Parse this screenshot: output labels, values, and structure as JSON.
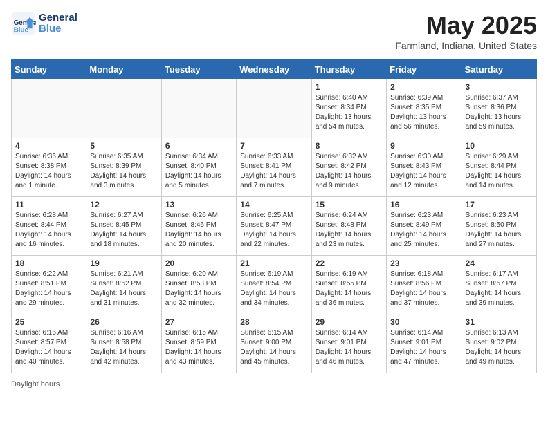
{
  "header": {
    "logo_text_general": "General",
    "logo_text_blue": "Blue",
    "month_title": "May 2025",
    "location": "Farmland, Indiana, United States"
  },
  "days_of_week": [
    "Sunday",
    "Monday",
    "Tuesday",
    "Wednesday",
    "Thursday",
    "Friday",
    "Saturday"
  ],
  "weeks": [
    [
      {
        "day": "",
        "info": ""
      },
      {
        "day": "",
        "info": ""
      },
      {
        "day": "",
        "info": ""
      },
      {
        "day": "",
        "info": ""
      },
      {
        "day": "1",
        "info": "Sunrise: 6:40 AM\nSunset: 8:34 PM\nDaylight: 13 hours\nand 54 minutes."
      },
      {
        "day": "2",
        "info": "Sunrise: 6:39 AM\nSunset: 8:35 PM\nDaylight: 13 hours\nand 56 minutes."
      },
      {
        "day": "3",
        "info": "Sunrise: 6:37 AM\nSunset: 8:36 PM\nDaylight: 13 hours\nand 59 minutes."
      }
    ],
    [
      {
        "day": "4",
        "info": "Sunrise: 6:36 AM\nSunset: 8:38 PM\nDaylight: 14 hours\nand 1 minute."
      },
      {
        "day": "5",
        "info": "Sunrise: 6:35 AM\nSunset: 8:39 PM\nDaylight: 14 hours\nand 3 minutes."
      },
      {
        "day": "6",
        "info": "Sunrise: 6:34 AM\nSunset: 8:40 PM\nDaylight: 14 hours\nand 5 minutes."
      },
      {
        "day": "7",
        "info": "Sunrise: 6:33 AM\nSunset: 8:41 PM\nDaylight: 14 hours\nand 7 minutes."
      },
      {
        "day": "8",
        "info": "Sunrise: 6:32 AM\nSunset: 8:42 PM\nDaylight: 14 hours\nand 9 minutes."
      },
      {
        "day": "9",
        "info": "Sunrise: 6:30 AM\nSunset: 8:43 PM\nDaylight: 14 hours\nand 12 minutes."
      },
      {
        "day": "10",
        "info": "Sunrise: 6:29 AM\nSunset: 8:44 PM\nDaylight: 14 hours\nand 14 minutes."
      }
    ],
    [
      {
        "day": "11",
        "info": "Sunrise: 6:28 AM\nSunset: 8:44 PM\nDaylight: 14 hours\nand 16 minutes."
      },
      {
        "day": "12",
        "info": "Sunrise: 6:27 AM\nSunset: 8:45 PM\nDaylight: 14 hours\nand 18 minutes."
      },
      {
        "day": "13",
        "info": "Sunrise: 6:26 AM\nSunset: 8:46 PM\nDaylight: 14 hours\nand 20 minutes."
      },
      {
        "day": "14",
        "info": "Sunrise: 6:25 AM\nSunset: 8:47 PM\nDaylight: 14 hours\nand 22 minutes."
      },
      {
        "day": "15",
        "info": "Sunrise: 6:24 AM\nSunset: 8:48 PM\nDaylight: 14 hours\nand 23 minutes."
      },
      {
        "day": "16",
        "info": "Sunrise: 6:23 AM\nSunset: 8:49 PM\nDaylight: 14 hours\nand 25 minutes."
      },
      {
        "day": "17",
        "info": "Sunrise: 6:23 AM\nSunset: 8:50 PM\nDaylight: 14 hours\nand 27 minutes."
      }
    ],
    [
      {
        "day": "18",
        "info": "Sunrise: 6:22 AM\nSunset: 8:51 PM\nDaylight: 14 hours\nand 29 minutes."
      },
      {
        "day": "19",
        "info": "Sunrise: 6:21 AM\nSunset: 8:52 PM\nDaylight: 14 hours\nand 31 minutes."
      },
      {
        "day": "20",
        "info": "Sunrise: 6:20 AM\nSunset: 8:53 PM\nDaylight: 14 hours\nand 32 minutes."
      },
      {
        "day": "21",
        "info": "Sunrise: 6:19 AM\nSunset: 8:54 PM\nDaylight: 14 hours\nand 34 minutes."
      },
      {
        "day": "22",
        "info": "Sunrise: 6:19 AM\nSunset: 8:55 PM\nDaylight: 14 hours\nand 36 minutes."
      },
      {
        "day": "23",
        "info": "Sunrise: 6:18 AM\nSunset: 8:56 PM\nDaylight: 14 hours\nand 37 minutes."
      },
      {
        "day": "24",
        "info": "Sunrise: 6:17 AM\nSunset: 8:57 PM\nDaylight: 14 hours\nand 39 minutes."
      }
    ],
    [
      {
        "day": "25",
        "info": "Sunrise: 6:16 AM\nSunset: 8:57 PM\nDaylight: 14 hours\nand 40 minutes."
      },
      {
        "day": "26",
        "info": "Sunrise: 6:16 AM\nSunset: 8:58 PM\nDaylight: 14 hours\nand 42 minutes."
      },
      {
        "day": "27",
        "info": "Sunrise: 6:15 AM\nSunset: 8:59 PM\nDaylight: 14 hours\nand 43 minutes."
      },
      {
        "day": "28",
        "info": "Sunrise: 6:15 AM\nSunset: 9:00 PM\nDaylight: 14 hours\nand 45 minutes."
      },
      {
        "day": "29",
        "info": "Sunrise: 6:14 AM\nSunset: 9:01 PM\nDaylight: 14 hours\nand 46 minutes."
      },
      {
        "day": "30",
        "info": "Sunrise: 6:14 AM\nSunset: 9:01 PM\nDaylight: 14 hours\nand 47 minutes."
      },
      {
        "day": "31",
        "info": "Sunrise: 6:13 AM\nSunset: 9:02 PM\nDaylight: 14 hours\nand 49 minutes."
      }
    ]
  ],
  "footer": {
    "daylight_label": "Daylight hours"
  }
}
